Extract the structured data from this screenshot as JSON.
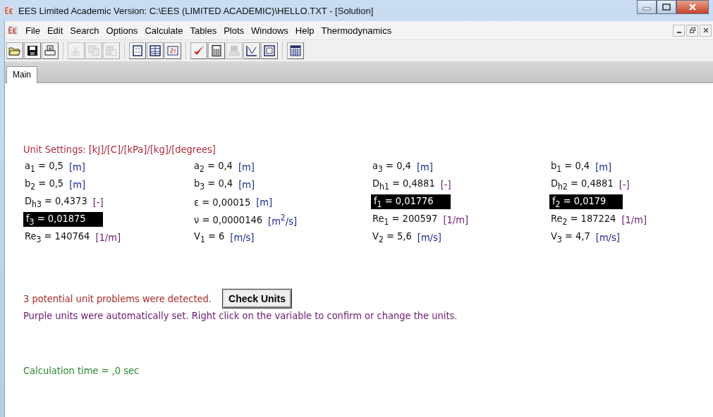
{
  "window": {
    "title": "EES Limited Academic Version:  C:\\EES (LIMITED ACADEMIC)\\HELLO.TXT - [Solution]"
  },
  "menu": [
    "File",
    "Edit",
    "Search",
    "Options",
    "Calculate",
    "Tables",
    "Plots",
    "Windows",
    "Help",
    "Thermodynamics"
  ],
  "toolbar": [
    [
      {
        "kind": "open",
        "disabled": false
      },
      {
        "kind": "save",
        "disabled": false
      },
      {
        "kind": "print",
        "disabled": false
      }
    ],
    [
      {
        "kind": "cut",
        "disabled": true
      },
      {
        "kind": "copy",
        "disabled": true
      },
      {
        "kind": "paste",
        "disabled": true
      }
    ],
    [
      {
        "kind": "equations",
        "disabled": false
      },
      {
        "kind": "table",
        "disabled": false
      },
      {
        "kind": "units",
        "disabled": false
      }
    ],
    [
      {
        "kind": "check",
        "disabled": false
      },
      {
        "kind": "calculator",
        "disabled": false
      },
      {
        "kind": "keyboard",
        "disabled": true
      },
      {
        "kind": "plot",
        "disabled": false
      },
      {
        "kind": "diagram",
        "disabled": false
      }
    ],
    [
      {
        "kind": "grid",
        "disabled": false
      }
    ]
  ],
  "tabs": [
    {
      "label": "Main",
      "selected": true
    }
  ],
  "unit_settings": "Unit Settings: [kJ]/[C]/[kPa]/[kg]/[degrees]",
  "variables": [
    {
      "name": "a$_{1}$",
      "value": "= 0,5",
      "unit": "[m]",
      "auto_unit": false,
      "highlighted": false
    },
    {
      "name": "a$_{2}$",
      "value": "= 0,4",
      "unit": "[m]",
      "auto_unit": false,
      "highlighted": false
    },
    {
      "name": "a$_{3}$",
      "value": "= 0,4",
      "unit": "[m]",
      "auto_unit": false,
      "highlighted": false
    },
    {
      "name": "b$_{1}$",
      "value": "= 0,4",
      "unit": "[m]",
      "auto_unit": false,
      "highlighted": false
    },
    {
      "name": "b$_{2}$",
      "value": "= 0,5",
      "unit": "[m]",
      "auto_unit": false,
      "highlighted": false
    },
    {
      "name": "b$_{3}$",
      "value": "= 0,4",
      "unit": "[m]",
      "auto_unit": false,
      "highlighted": false
    },
    {
      "name": "D$_{h1}$",
      "value": "= 0,4881",
      "unit": "[-]",
      "auto_unit": true,
      "highlighted": false
    },
    {
      "name": "D$_{h2}$",
      "value": "= 0,4881",
      "unit": "[-]",
      "auto_unit": true,
      "highlighted": false
    },
    {
      "name": "D$_{h3}$",
      "value": "= 0,4373",
      "unit": "[-]",
      "auto_unit": true,
      "highlighted": false
    },
    {
      "name": "ε",
      "value": "= 0,00015",
      "unit": "[m]",
      "auto_unit": false,
      "highlighted": false
    },
    {
      "name": "f$_{1}$",
      "value": "= 0,01776",
      "highlighted": true
    },
    {
      "name": "f$_{2}$",
      "value": "= 0,0179",
      "highlighted": true
    },
    {
      "name": "f$_{3}$",
      "value": "= 0,01875",
      "highlighted": true
    },
    {
      "name": "ν",
      "value": "= 0,0000146",
      "unit": "[m$^{2}$/s]",
      "auto_unit": false,
      "highlighted": false
    },
    {
      "name": "Re$_{1}$",
      "value": "= 200597",
      "unit": "[1/m]",
      "auto_unit": true,
      "highlighted": false
    },
    {
      "name": "Re$_{2}$",
      "value": "= 187224",
      "unit": "[1/m]",
      "auto_unit": true,
      "highlighted": false
    },
    {
      "name": "Re$_{3}$",
      "value": "= 140764",
      "unit": "[1/m]",
      "auto_unit": true,
      "highlighted": false
    },
    {
      "name": "V$_{1}$",
      "value": "= 6",
      "unit": "[m/s]",
      "auto_unit": false,
      "highlighted": false
    },
    {
      "name": "V$_{2}$",
      "value": "= 5,6",
      "unit": "[m/s]",
      "auto_unit": false,
      "highlighted": false
    },
    {
      "name": "V$_{3}$",
      "value": "= 4,7",
      "unit": "[m/s]",
      "auto_unit": false,
      "highlighted": false
    }
  ],
  "problems": {
    "message": "3 potential unit problems were detected.",
    "button": "Check Units"
  },
  "note": "Purple units were automatically set.  Right click on the variable to confirm or change the units.",
  "calc_time": "Calculation time = ,0 sec"
}
